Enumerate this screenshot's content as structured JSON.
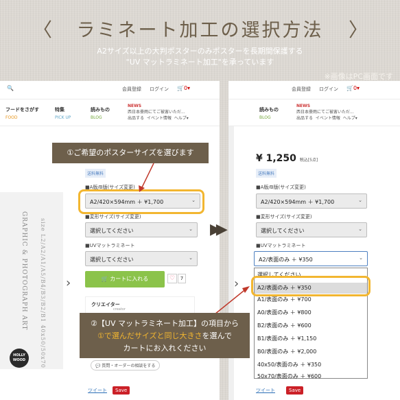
{
  "header": {
    "title": "ラミネート加工の選択方法",
    "chevron_left": "〈",
    "chevron_right": "〉",
    "subtitle_1": "A2サイズ以上の大判ポスターのみポスターを長期間保護する",
    "subtitle_2": "\"UV マットラミネート加工\"を承っています",
    "note": "※画像はPC画面です"
  },
  "topbar": {
    "member": "会員登録",
    "login": "ログイン",
    "cart": "🛒0▾"
  },
  "nav": {
    "food_jp": "フードをさがす",
    "food_en": "FOOD",
    "pickup_jp": "特集",
    "pickup_en": "PICK UP",
    "blog_jp": "読みもの",
    "blog_en": "BLOG",
    "news_tag": "NEWS",
    "news_text": "西日本豪雨にてご被害いただ...",
    "ship": "出品する",
    "event": "イベント情報",
    "help": "ヘルプ▾"
  },
  "product": {
    "free_shipping": "送料無料",
    "price": "¥ 1,250",
    "price_tax": "税込[5点]",
    "size_label": "■A版/B版(サイズ変更)",
    "size_value": "A2/420×594mm ＋ ¥1,700",
    "variant_label": "■変形サイズ(サイズ変更)",
    "variant_value": "選択してください",
    "uv_label": "■UVマットラミネート",
    "uv_value": "選択してください",
    "uv_value_right": "A2/表面のみ ＋ ¥350",
    "add_to_cart": "🛒 カートに入れる",
    "heart": "♡",
    "fav_count": "7",
    "creator": "クリエイター",
    "creator_sub": "creator",
    "consult": "💬 質問・オーダーの相談をする",
    "tweet": "ツイート",
    "save": "Save"
  },
  "poster": {
    "line1": "GRAPHIC & PHOTOGRAPH ART",
    "line2": "size L2/A2/A1/A5/B4/B3/B2/B1",
    "line3": "40x50/50x70",
    "badge_top": "HOLLY",
    "badge_bottom": "WOOD"
  },
  "dropdown": {
    "items": [
      "選択してください",
      "A2/表面のみ ＋ ¥350",
      "A1/表面のみ ＋ ¥700",
      "A0/表面のみ ＋ ¥800",
      "B2/表面のみ ＋ ¥600",
      "B1/表面のみ ＋ ¥1,150",
      "B0/表面のみ ＋ ¥2,000",
      "40x50/表面のみ ＋ ¥350",
      "50x70/表面のみ ＋ ¥600"
    ]
  },
  "callouts": {
    "step1": "①ご希望のポスターサイズを選びます",
    "step2_line1": "②【UV マットラミネート加工】の項目から",
    "step2_line2_hl": "①で選んだサイズと同じ大きさ",
    "step2_line2_rest": "を選んで",
    "step2_line3": "カートにお入れください"
  },
  "colors": {
    "brown": "#6d5f4b",
    "highlight": "#f2b630",
    "cart_green": "#8bc34a",
    "accent_red": "#cc3333"
  }
}
